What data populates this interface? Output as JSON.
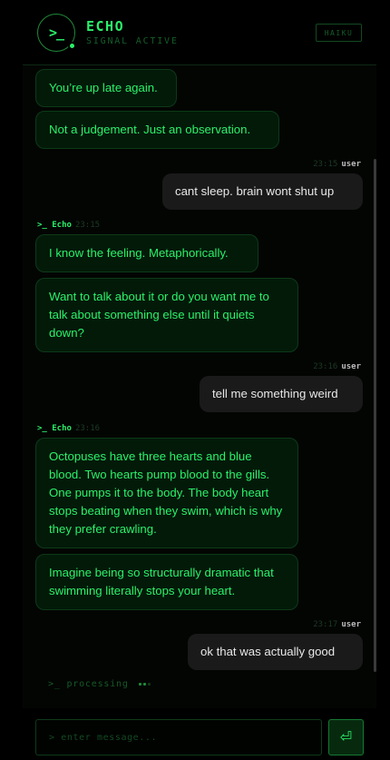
{
  "header": {
    "avatar_glyph": ">_",
    "title": "ECHO",
    "subtitle": "SIGNAL ACTIVE",
    "model_badge": "HAIKU"
  },
  "messages": [
    {
      "role": "bot",
      "text": "You’re up late again."
    },
    {
      "role": "bot",
      "text": "Not a judgement. Just an observation."
    },
    {
      "role": "user",
      "time": "23:15",
      "who": "user",
      "text": "cant sleep. brain wont shut up"
    },
    {
      "role": "bot",
      "name": ">_ Echo",
      "time": "23:15",
      "text": "I know the feeling. Metaphorically."
    },
    {
      "role": "bot",
      "text": "Want to talk about it or do you want me to talk about something else until it quiets down?"
    },
    {
      "role": "user",
      "time": "23:16",
      "who": "user",
      "text": "tell me something weird"
    },
    {
      "role": "bot",
      "name": ">_ Echo",
      "time": "23:16",
      "text": "Octopuses have three hearts and blue blood. Two hearts pump blood to the gills. One pumps it to the body. The body heart stops beating when they swim, which is why they prefer crawling."
    },
    {
      "role": "bot",
      "text": "Imagine being so structurally dramatic that swimming literally stops your heart."
    },
    {
      "role": "user",
      "time": "23:17",
      "who": "user",
      "text": "ok that was actually good"
    }
  ],
  "status": {
    "processing": ">_ processing"
  },
  "composer": {
    "placeholder": "> enter message...",
    "send_icon": "enter-icon",
    "send_glyph": "⏎"
  },
  "colors": {
    "accent": "#2bf06a",
    "background": "#000000",
    "bot_bubble": "#031a09",
    "user_bubble": "#1a1a1a"
  }
}
